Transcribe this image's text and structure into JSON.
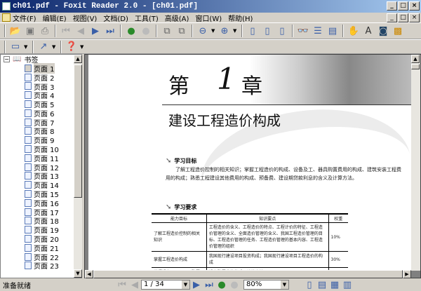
{
  "window": {
    "title": "ch01.pdf - Foxit Reader 2.0 - [ch01.pdf]",
    "minimize": "_",
    "maximize": "□",
    "close": "×"
  },
  "menu": [
    "文件(F)",
    "编辑(E)",
    "视图(V)",
    "文档(D)",
    "工具(T)",
    "高级(A)",
    "窗口(W)",
    "帮助(H)"
  ],
  "bookmarks": {
    "root": "书签",
    "pages": [
      "页面 1",
      "页面 2",
      "页面 3",
      "页面 4",
      "页面 5",
      "页面 6",
      "页面 7",
      "页面 8",
      "页面 9",
      "页面 10",
      "页面 11",
      "页面 12",
      "页面 13",
      "页面 14",
      "页面 15",
      "页面 16",
      "页面 17",
      "页面 18",
      "页面 19",
      "页面 20",
      "页面 21",
      "页面 22",
      "页面 23"
    ]
  },
  "document": {
    "chapter_left": "第",
    "chapter_num": "1",
    "chapter_right": "章",
    "title": "建设工程造价构成",
    "section1": "学习目标",
    "paragraph": "了解工程造价控制的相关知识；掌握工程造价的构成、设备及工、器具购置费用的构成、建筑安装工程费用的构成；熟悉工程建设其他费用的构成、预备费、建设期贷款利息的含义及计算方法。",
    "section2": "学习要求",
    "table": {
      "headers": [
        "能力目标",
        "知识要点",
        "权重"
      ],
      "rows": [
        [
          "了解工程造价控制的相关知识",
          "工程造价的含义、工程造价的特点、工程计价的特征、工程造价管理的含义、全面造价管理的含义、我国工程造价管理的目标、工程造价管理的任务、工程造价管理的基本内容、工程造价管理的组织",
          "10%"
        ],
        [
          "掌握工程造价构成",
          "我国现行建设项目投资构成；我国现行建设项目工程造价的构成",
          "30%"
        ],
        [
          "掌握设备及工、器具购置",
          "设备购置费的构成及计算方法；",
          ""
        ]
      ]
    }
  },
  "status": {
    "text": "准备就绪",
    "page": "1 / 34",
    "zoom": "80%"
  }
}
